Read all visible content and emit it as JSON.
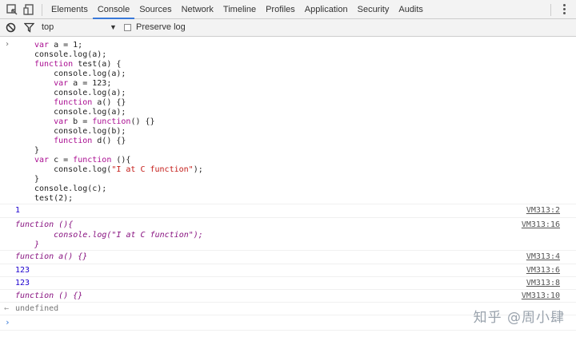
{
  "toolbar": {
    "tabs": [
      "Elements",
      "Console",
      "Sources",
      "Network",
      "Timeline",
      "Profiles",
      "Application",
      "Security",
      "Audits"
    ],
    "active_tab": "Console"
  },
  "filterbar": {
    "context": "top",
    "preserve_log_label": "Preserve log",
    "preserve_log_checked": false
  },
  "input": {
    "prompt": "›",
    "lines": [
      {
        "parts": [
          {
            "t": "var",
            "c": "kw"
          },
          {
            "t": " a = 1;"
          }
        ]
      },
      {
        "parts": [
          {
            "t": "console.log(a);"
          }
        ]
      },
      {
        "parts": [
          {
            "t": "function",
            "c": "kw"
          },
          {
            "t": " test(a) {"
          }
        ]
      },
      {
        "parts": [
          {
            "t": "    console.log(a);"
          }
        ]
      },
      {
        "parts": [
          {
            "t": "    "
          },
          {
            "t": "var",
            "c": "kw"
          },
          {
            "t": " a = 123;"
          }
        ]
      },
      {
        "parts": [
          {
            "t": "    console.log(a);"
          }
        ]
      },
      {
        "parts": [
          {
            "t": "    "
          },
          {
            "t": "function",
            "c": "kw"
          },
          {
            "t": " a() {}"
          }
        ]
      },
      {
        "parts": [
          {
            "t": "    console.log(a);"
          }
        ]
      },
      {
        "parts": [
          {
            "t": "    "
          },
          {
            "t": "var",
            "c": "kw"
          },
          {
            "t": " b = "
          },
          {
            "t": "function",
            "c": "kw"
          },
          {
            "t": "() {}"
          }
        ]
      },
      {
        "parts": [
          {
            "t": "    console.log(b);"
          }
        ]
      },
      {
        "parts": [
          {
            "t": "    "
          },
          {
            "t": "function",
            "c": "kw"
          },
          {
            "t": " d() {}"
          }
        ]
      },
      {
        "parts": [
          {
            "t": "}"
          }
        ]
      },
      {
        "parts": [
          {
            "t": "var",
            "c": "kw"
          },
          {
            "t": " c = "
          },
          {
            "t": "function",
            "c": "kw"
          },
          {
            "t": " (){"
          }
        ]
      },
      {
        "parts": [
          {
            "t": "    console.log("
          },
          {
            "t": "\"I at C function\"",
            "c": "str"
          },
          {
            "t": ");"
          }
        ]
      },
      {
        "parts": [
          {
            "t": "}"
          }
        ]
      },
      {
        "parts": [
          {
            "t": "console.log(c);"
          }
        ]
      },
      {
        "parts": [
          {
            "t": "test(2);"
          }
        ]
      }
    ]
  },
  "output": {
    "row1": {
      "text": "1",
      "source": "VM313:2"
    },
    "row2": {
      "line1": "function (){",
      "line2": "        console.log(\"I at C function\");",
      "line3": "    }",
      "source": "VM313:16"
    },
    "row3": {
      "text": "function a() {}",
      "source": "VM313:4"
    },
    "row4": {
      "text": "123",
      "source": "VM313:6"
    },
    "row5": {
      "text": "123",
      "source": "VM313:8"
    },
    "row6": {
      "text": "function () {}",
      "source": "VM313:10"
    },
    "result": {
      "arrow": "←",
      "text": "undefined"
    },
    "caret": "›"
  },
  "watermark": "知乎 @周小肆",
  "colors": {
    "accent": "#3879d9",
    "keyword": "#aa0d91",
    "string": "#c41a16",
    "number": "#1c00cf"
  }
}
